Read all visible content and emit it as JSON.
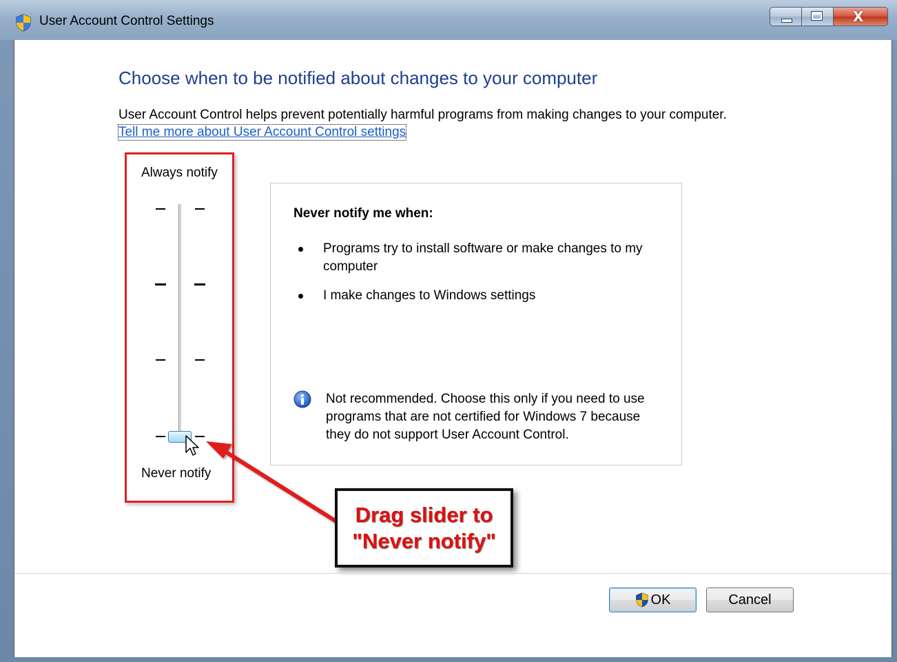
{
  "window": {
    "title": "User Account Control Settings",
    "title_icon": "uac-shield-icon",
    "controls": {
      "minimize": "minimize-icon",
      "maximize": "maximize-icon",
      "close_glyph": "X"
    }
  },
  "content": {
    "heading": "Choose when to be notified about changes to your computer",
    "description": "User Account Control helps prevent potentially harmful programs from making changes to your computer.",
    "help_link": "Tell me more about User Account Control settings"
  },
  "slider": {
    "top_label": "Always notify",
    "bottom_label": "Never notify",
    "levels": 4,
    "selected_level": 1,
    "selected_level_name": "Never notify"
  },
  "panel": {
    "title": "Never notify me when:",
    "bullets": [
      "Programs try to install software or make changes to my computer",
      "I make changes to Windows settings"
    ],
    "note_icon": "info-icon",
    "note": "Not recommended. Choose this only if you need to use programs that are not certified for Windows 7 because they do not support User Account Control."
  },
  "annotation": {
    "line1": "Drag slider to",
    "line2": "\"Never notify\"",
    "color": "#e01010"
  },
  "buttons": {
    "ok": "OK",
    "cancel": "Cancel"
  },
  "colors": {
    "heading": "#1e3f8f",
    "link": "#1a5fc9",
    "highlight_border": "#e02020",
    "titlebar": "#97afc9"
  }
}
